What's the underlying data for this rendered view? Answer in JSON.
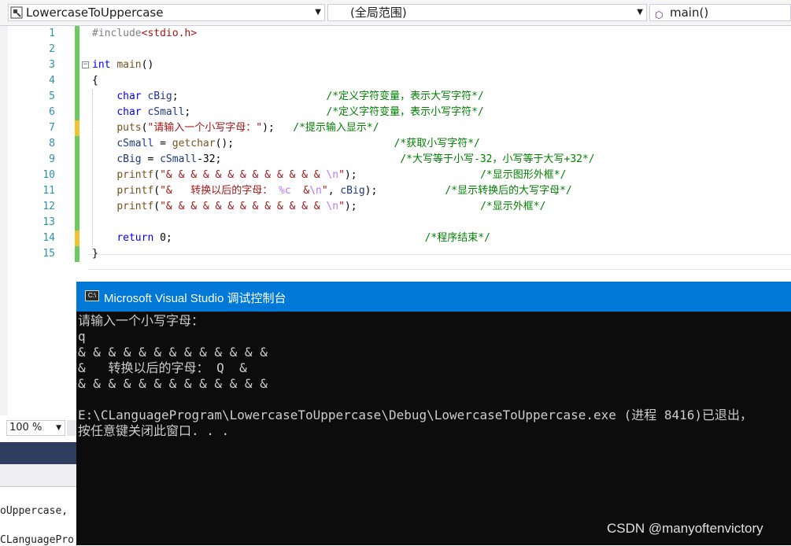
{
  "navbar": {
    "project_combo": "LowercaseToUppercase",
    "scope_combo": "(全局范围)",
    "member_combo": "main()"
  },
  "colors": {
    "keyword": "#0000ff",
    "comment": "#008000",
    "string": "#a31515",
    "console_title_bar": "#0078d7",
    "console_bg": "#0c0c0c",
    "change_saved": "#6ccb5f",
    "change_unsaved": "#f1c232"
  },
  "editor": {
    "lines": [
      {
        "n": "1",
        "parts": [
          {
            "c": "pp",
            "t": "#include"
          },
          {
            "c": "str",
            "t": "<stdio.h>"
          }
        ]
      },
      {
        "n": "2",
        "parts": []
      },
      {
        "n": "3",
        "parts": [
          {
            "c": "kw",
            "t": "int"
          },
          {
            "c": "",
            "t": " "
          },
          {
            "c": "fn",
            "t": "main"
          },
          {
            "c": "",
            "t": "()"
          }
        ]
      },
      {
        "n": "4",
        "parts": [
          {
            "c": "",
            "t": "{"
          }
        ]
      },
      {
        "n": "5",
        "parts": [
          {
            "c": "",
            "t": "    "
          },
          {
            "c": "kw",
            "t": "char"
          },
          {
            "c": "",
            "t": " "
          },
          {
            "c": "var",
            "t": "cBig"
          },
          {
            "c": "",
            "t": ";                        "
          },
          {
            "c": "cm",
            "t": "/*定义字符变量，表示大写字符*/"
          }
        ]
      },
      {
        "n": "6",
        "parts": [
          {
            "c": "",
            "t": "    "
          },
          {
            "c": "kw",
            "t": "char"
          },
          {
            "c": "",
            "t": " "
          },
          {
            "c": "var",
            "t": "cSmall"
          },
          {
            "c": "",
            "t": ";                      "
          },
          {
            "c": "cm",
            "t": "/*定义字符变量，表示小写字符*/"
          }
        ]
      },
      {
        "n": "7",
        "parts": [
          {
            "c": "",
            "t": "    "
          },
          {
            "c": "fn",
            "t": "puts"
          },
          {
            "c": "",
            "t": "("
          },
          {
            "c": "str",
            "t": "\"请输入一个小写字母：\""
          },
          {
            "c": "",
            "t": ");   "
          },
          {
            "c": "cm",
            "t": "/*提示输入显示*/"
          }
        ]
      },
      {
        "n": "8",
        "parts": [
          {
            "c": "",
            "t": "    "
          },
          {
            "c": "var",
            "t": "cSmall"
          },
          {
            "c": "",
            "t": " = "
          },
          {
            "c": "fn",
            "t": "getchar"
          },
          {
            "c": "",
            "t": "();                          "
          },
          {
            "c": "cm",
            "t": "/*获取小写字符*/"
          }
        ]
      },
      {
        "n": "9",
        "parts": [
          {
            "c": "",
            "t": "    "
          },
          {
            "c": "var",
            "t": "cBig"
          },
          {
            "c": "",
            "t": " = "
          },
          {
            "c": "var",
            "t": "cSmall"
          },
          {
            "c": "",
            "t": "-32;                             "
          },
          {
            "c": "cm",
            "t": "/*大写等于小写-32，小写等于大写+32*/"
          }
        ]
      },
      {
        "n": "10",
        "parts": [
          {
            "c": "",
            "t": "    "
          },
          {
            "c": "fn",
            "t": "printf"
          },
          {
            "c": "",
            "t": "("
          },
          {
            "c": "str",
            "t": "\"& & & & & & & & & & & & & "
          },
          {
            "c": "esc",
            "t": "\\n"
          },
          {
            "c": "str",
            "t": "\""
          },
          {
            "c": "",
            "t": ");                    "
          },
          {
            "c": "cm",
            "t": "/*显示图形外框*/"
          }
        ]
      },
      {
        "n": "11",
        "parts": [
          {
            "c": "",
            "t": "    "
          },
          {
            "c": "fn",
            "t": "printf"
          },
          {
            "c": "",
            "t": "("
          },
          {
            "c": "str",
            "t": "\"&   转换以后的字母： "
          },
          {
            "c": "esc",
            "t": "%c"
          },
          {
            "c": "str",
            "t": "  &"
          },
          {
            "c": "esc",
            "t": "\\n"
          },
          {
            "c": "str",
            "t": "\""
          },
          {
            "c": "",
            "t": ", "
          },
          {
            "c": "var",
            "t": "cBig"
          },
          {
            "c": "",
            "t": ");           "
          },
          {
            "c": "cm",
            "t": "/*显示转换后的大写字母*/"
          }
        ]
      },
      {
        "n": "12",
        "parts": [
          {
            "c": "",
            "t": "    "
          },
          {
            "c": "fn",
            "t": "printf"
          },
          {
            "c": "",
            "t": "("
          },
          {
            "c": "str",
            "t": "\"& & & & & & & & & & & & & "
          },
          {
            "c": "esc",
            "t": "\\n"
          },
          {
            "c": "str",
            "t": "\""
          },
          {
            "c": "",
            "t": ");                    "
          },
          {
            "c": "cm",
            "t": "/*显示外框*/"
          }
        ]
      },
      {
        "n": "13",
        "parts": []
      },
      {
        "n": "14",
        "parts": [
          {
            "c": "",
            "t": "    "
          },
          {
            "c": "kw",
            "t": "return"
          },
          {
            "c": "",
            "t": " 0;                                         "
          },
          {
            "c": "cm",
            "t": "/*程序结束*/"
          }
        ]
      },
      {
        "n": "15",
        "parts": [
          {
            "c": "",
            "t": "}"
          }
        ]
      }
    ],
    "change_marks": [
      "green",
      "green",
      "green",
      "green",
      "green",
      "green",
      "yellow",
      "green",
      "green",
      "green",
      "green",
      "green",
      "green",
      "yellow",
      "green"
    ]
  },
  "zoom": {
    "value": "100 %"
  },
  "side_panel": {
    "line1": "oUppercase,",
    "line2": "CLanguagePro"
  },
  "console": {
    "title": "Microsoft Visual Studio 调试控制台",
    "icon_text": "C:\\",
    "lines": [
      "请输入一个小写字母：",
      "q",
      "& & & & & & & & & & & & &",
      "&   转换以后的字母： Q  &",
      "& & & & & & & & & & & & &",
      "",
      "E:\\CLanguageProgram\\LowercaseToUppercase\\Debug\\LowercaseToUppercase.exe (进程 8416)已退出，",
      "按任意键关闭此窗口. . ."
    ]
  },
  "watermark": "CSDN @manyoftenvictory"
}
